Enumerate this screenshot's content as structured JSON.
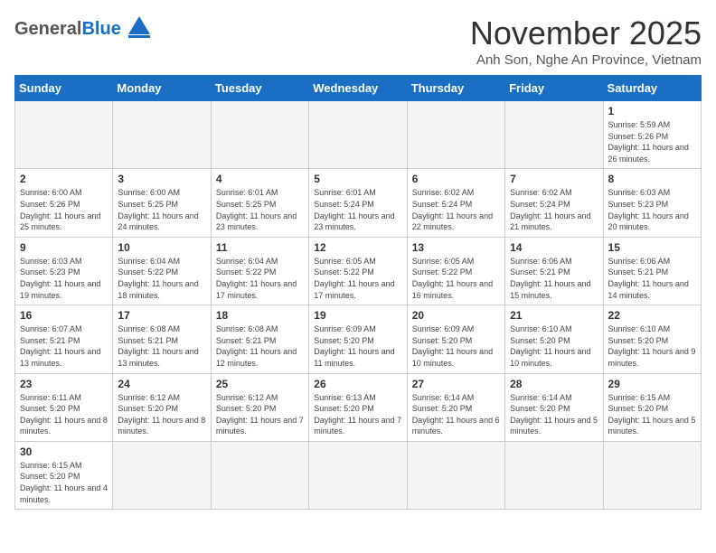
{
  "header": {
    "logo_general": "General",
    "logo_blue": "Blue",
    "month_title": "November 2025",
    "location": "Anh Son, Nghe An Province, Vietnam"
  },
  "weekdays": [
    "Sunday",
    "Monday",
    "Tuesday",
    "Wednesday",
    "Thursday",
    "Friday",
    "Saturday"
  ],
  "days": [
    {
      "num": "",
      "info": ""
    },
    {
      "num": "",
      "info": ""
    },
    {
      "num": "",
      "info": ""
    },
    {
      "num": "",
      "info": ""
    },
    {
      "num": "",
      "info": ""
    },
    {
      "num": "",
      "info": ""
    },
    {
      "num": "1",
      "info": "Sunrise: 5:59 AM\nSunset: 5:26 PM\nDaylight: 11 hours and 26 minutes."
    },
    {
      "num": "2",
      "info": "Sunrise: 6:00 AM\nSunset: 5:26 PM\nDaylight: 11 hours and 25 minutes."
    },
    {
      "num": "3",
      "info": "Sunrise: 6:00 AM\nSunset: 5:25 PM\nDaylight: 11 hours and 24 minutes."
    },
    {
      "num": "4",
      "info": "Sunrise: 6:01 AM\nSunset: 5:25 PM\nDaylight: 11 hours and 23 minutes."
    },
    {
      "num": "5",
      "info": "Sunrise: 6:01 AM\nSunset: 5:24 PM\nDaylight: 11 hours and 23 minutes."
    },
    {
      "num": "6",
      "info": "Sunrise: 6:02 AM\nSunset: 5:24 PM\nDaylight: 11 hours and 22 minutes."
    },
    {
      "num": "7",
      "info": "Sunrise: 6:02 AM\nSunset: 5:24 PM\nDaylight: 11 hours and 21 minutes."
    },
    {
      "num": "8",
      "info": "Sunrise: 6:03 AM\nSunset: 5:23 PM\nDaylight: 11 hours and 20 minutes."
    },
    {
      "num": "9",
      "info": "Sunrise: 6:03 AM\nSunset: 5:23 PM\nDaylight: 11 hours and 19 minutes."
    },
    {
      "num": "10",
      "info": "Sunrise: 6:04 AM\nSunset: 5:22 PM\nDaylight: 11 hours and 18 minutes."
    },
    {
      "num": "11",
      "info": "Sunrise: 6:04 AM\nSunset: 5:22 PM\nDaylight: 11 hours and 17 minutes."
    },
    {
      "num": "12",
      "info": "Sunrise: 6:05 AM\nSunset: 5:22 PM\nDaylight: 11 hours and 17 minutes."
    },
    {
      "num": "13",
      "info": "Sunrise: 6:05 AM\nSunset: 5:22 PM\nDaylight: 11 hours and 16 minutes."
    },
    {
      "num": "14",
      "info": "Sunrise: 6:06 AM\nSunset: 5:21 PM\nDaylight: 11 hours and 15 minutes."
    },
    {
      "num": "15",
      "info": "Sunrise: 6:06 AM\nSunset: 5:21 PM\nDaylight: 11 hours and 14 minutes."
    },
    {
      "num": "16",
      "info": "Sunrise: 6:07 AM\nSunset: 5:21 PM\nDaylight: 11 hours and 13 minutes."
    },
    {
      "num": "17",
      "info": "Sunrise: 6:08 AM\nSunset: 5:21 PM\nDaylight: 11 hours and 13 minutes."
    },
    {
      "num": "18",
      "info": "Sunrise: 6:08 AM\nSunset: 5:21 PM\nDaylight: 11 hours and 12 minutes."
    },
    {
      "num": "19",
      "info": "Sunrise: 6:09 AM\nSunset: 5:20 PM\nDaylight: 11 hours and 11 minutes."
    },
    {
      "num": "20",
      "info": "Sunrise: 6:09 AM\nSunset: 5:20 PM\nDaylight: 11 hours and 10 minutes."
    },
    {
      "num": "21",
      "info": "Sunrise: 6:10 AM\nSunset: 5:20 PM\nDaylight: 11 hours and 10 minutes."
    },
    {
      "num": "22",
      "info": "Sunrise: 6:10 AM\nSunset: 5:20 PM\nDaylight: 11 hours and 9 minutes."
    },
    {
      "num": "23",
      "info": "Sunrise: 6:11 AM\nSunset: 5:20 PM\nDaylight: 11 hours and 8 minutes."
    },
    {
      "num": "24",
      "info": "Sunrise: 6:12 AM\nSunset: 5:20 PM\nDaylight: 11 hours and 8 minutes."
    },
    {
      "num": "25",
      "info": "Sunrise: 6:12 AM\nSunset: 5:20 PM\nDaylight: 11 hours and 7 minutes."
    },
    {
      "num": "26",
      "info": "Sunrise: 6:13 AM\nSunset: 5:20 PM\nDaylight: 11 hours and 7 minutes."
    },
    {
      "num": "27",
      "info": "Sunrise: 6:14 AM\nSunset: 5:20 PM\nDaylight: 11 hours and 6 minutes."
    },
    {
      "num": "28",
      "info": "Sunrise: 6:14 AM\nSunset: 5:20 PM\nDaylight: 11 hours and 5 minutes."
    },
    {
      "num": "29",
      "info": "Sunrise: 6:15 AM\nSunset: 5:20 PM\nDaylight: 11 hours and 5 minutes."
    },
    {
      "num": "30",
      "info": "Sunrise: 6:15 AM\nSunset: 5:20 PM\nDaylight: 11 hours and 4 minutes."
    },
    {
      "num": "",
      "info": ""
    },
    {
      "num": "",
      "info": ""
    },
    {
      "num": "",
      "info": ""
    },
    {
      "num": "",
      "info": ""
    },
    {
      "num": "",
      "info": ""
    },
    {
      "num": "",
      "info": ""
    }
  ]
}
